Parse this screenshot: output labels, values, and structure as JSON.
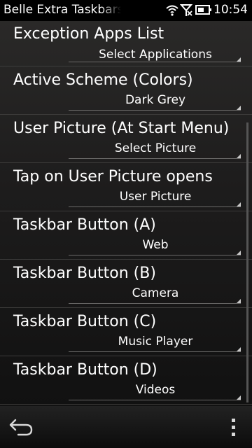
{
  "status_bar": {
    "app_title": "Belle Extra Taskbars",
    "time": "10:54"
  },
  "settings": [
    {
      "title": "Exception Apps List",
      "value": "Select Applications"
    },
    {
      "title": "Active Scheme (Colors)",
      "value": "Dark Grey"
    },
    {
      "title": "User Picture (At Start Menu)",
      "value": "Select Picture"
    },
    {
      "title": "Tap on User Picture opens",
      "value": "User Picture"
    },
    {
      "title": "Taskbar Button (A)",
      "value": "Web"
    },
    {
      "title": "Taskbar Button (B)",
      "value": "Camera"
    },
    {
      "title": "Taskbar Button (C)",
      "value": "Music Player"
    },
    {
      "title": "Taskbar Button (D)",
      "value": "Videos"
    }
  ],
  "toolbar": {
    "back_icon": "back-arrow-icon",
    "options_icon": "more-options-icon"
  },
  "colors": {
    "background": "#000000",
    "list_background": "#222121",
    "text": "#ffffff",
    "divider": "#3c3b3a"
  }
}
